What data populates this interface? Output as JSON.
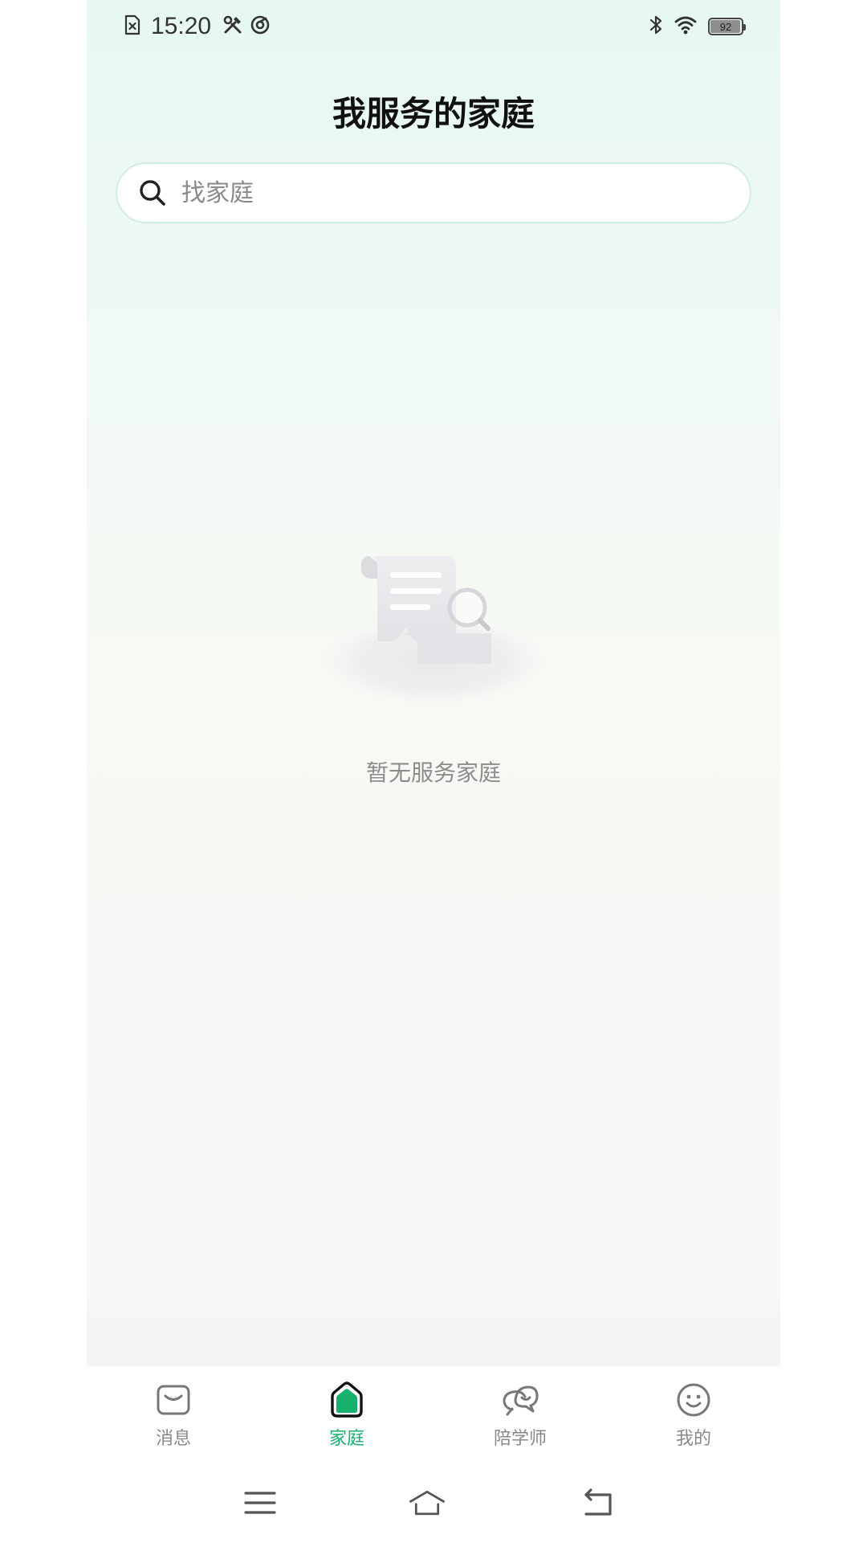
{
  "status_bar": {
    "time": "15:20",
    "battery_level": "92",
    "battery_fraction": 0.92,
    "left_icons": [
      "sim-error-icon",
      "tools-icon",
      "sync-icon"
    ],
    "right_icons": [
      "bluetooth-icon",
      "wifi-icon",
      "battery-icon"
    ]
  },
  "header": {
    "title": "我服务的家庭"
  },
  "search": {
    "placeholder": "找家庭",
    "value": "",
    "icon": "search-icon"
  },
  "empty_state": {
    "icon": "empty-document-search-icon",
    "message": "暂无服务家庭"
  },
  "tab_bar": {
    "active_color": "#17b06d",
    "inactive_color": "#888888",
    "tabs": [
      {
        "label": "消息",
        "icon": "message-icon",
        "active": false
      },
      {
        "label": "家庭",
        "icon": "home-icon",
        "active": true
      },
      {
        "label": "陪学师",
        "icon": "chat-bubbles-icon",
        "active": false
      },
      {
        "label": "我的",
        "icon": "smiley-icon",
        "active": false
      }
    ]
  },
  "nav_bar": {
    "buttons": [
      "menu-icon",
      "home-nav-icon",
      "back-icon"
    ]
  }
}
